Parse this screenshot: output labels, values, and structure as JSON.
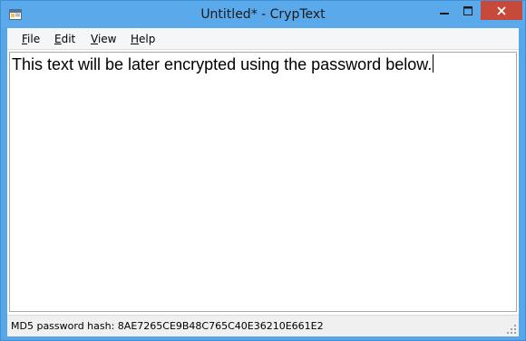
{
  "window": {
    "title": "Untitled* - CrypText",
    "accent_color": "#5aa9ea",
    "close_color": "#c7493a",
    "icons": {
      "app": "app-icon",
      "minimize": "minimize-icon",
      "maximize": "maximize-icon",
      "close": "close-icon"
    }
  },
  "menu": {
    "items": [
      {
        "label": "File",
        "access_key": "F",
        "rest": "ile"
      },
      {
        "label": "Edit",
        "access_key": "E",
        "rest": "dit"
      },
      {
        "label": "View",
        "access_key": "V",
        "rest": "iew"
      },
      {
        "label": "Help",
        "access_key": "H",
        "rest": "elp"
      }
    ]
  },
  "editor": {
    "text": "This text will be later encrypted using the password below."
  },
  "status": {
    "text": "MD5 password hash: 8AE7265CE9B48C765C40E36210E661E2",
    "grip_icon": "resize-grip-icon"
  }
}
